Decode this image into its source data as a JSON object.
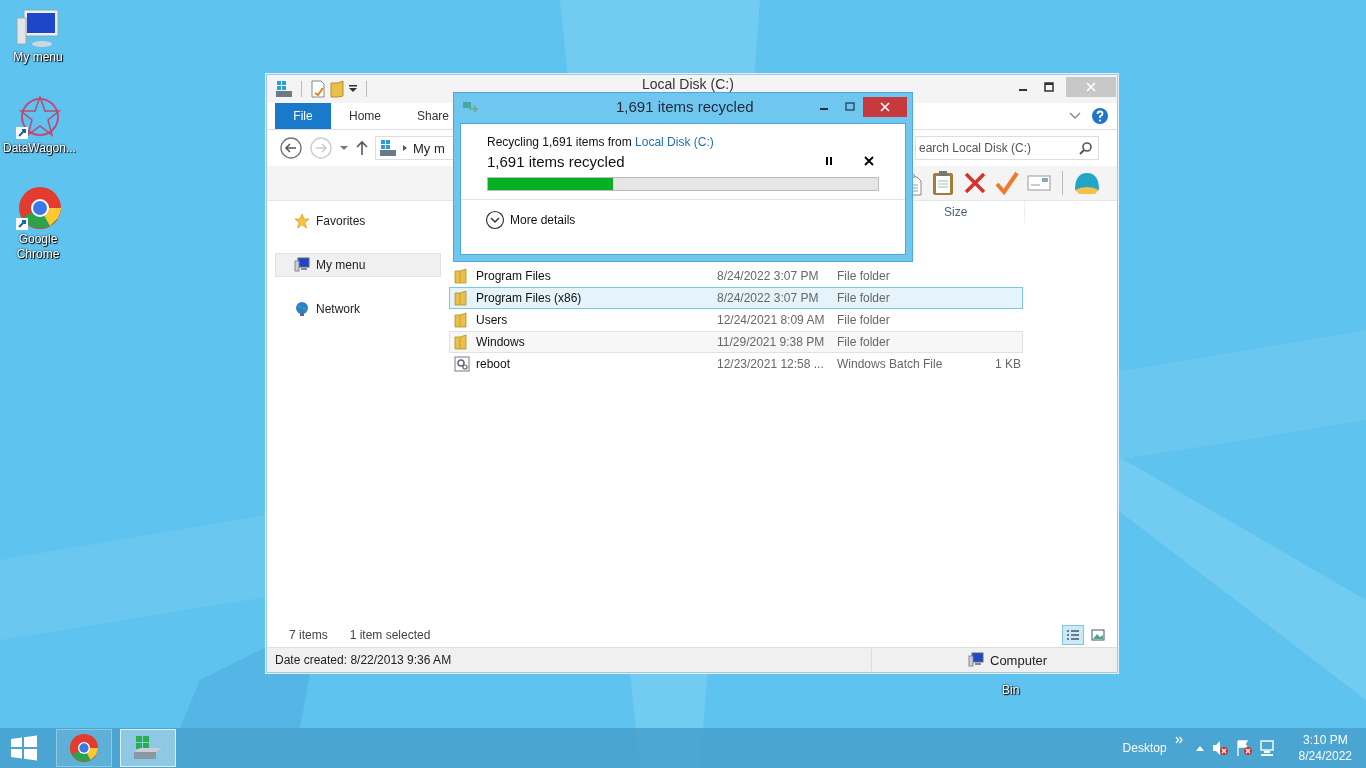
{
  "desktop_icons": [
    {
      "label": "My menu",
      "kind": "computer"
    },
    {
      "label": "DataWagon...",
      "kind": "star"
    },
    {
      "label": "Google Chrome",
      "kind": "chrome"
    }
  ],
  "recycle_bin": {
    "label": "Bin"
  },
  "explorer": {
    "title": "Local Disk (C:)",
    "ribbon_tabs": [
      {
        "label": "File",
        "kind": "menu"
      },
      {
        "label": "Home",
        "kind": "tab"
      },
      {
        "label": "Share",
        "kind": "tab"
      }
    ],
    "breadcrumb": "My m",
    "search": {
      "placeholder": "earch Local Disk (C:)"
    },
    "nav": [
      {
        "label": "Favorites",
        "kind": "favorites",
        "selected": false
      },
      {
        "label": "My menu",
        "kind": "computer",
        "selected": true
      },
      {
        "label": "Network",
        "kind": "network",
        "selected": false
      }
    ],
    "size_column": "Size",
    "rows": [
      {
        "name": "Program Files",
        "date": "8/24/2022 3:07 PM",
        "type": "File folder",
        "size": "",
        "kind": "folder",
        "selected": false,
        "hovered": false
      },
      {
        "name": "Program Files (x86)",
        "date": "8/24/2022 3:07 PM",
        "type": "File folder",
        "size": "",
        "kind": "folder",
        "selected": true,
        "hovered": false
      },
      {
        "name": "Users",
        "date": "12/24/2021 8:09 AM",
        "type": "File folder",
        "size": "",
        "kind": "folder",
        "selected": false,
        "hovered": false
      },
      {
        "name": "Windows",
        "date": "11/29/2021 9:38 PM",
        "type": "File folder",
        "size": "",
        "kind": "folder",
        "selected": false,
        "hovered": true
      },
      {
        "name": "reboot",
        "date": "12/23/2021 12:58 ...",
        "type": "Windows Batch File",
        "size": "1 KB",
        "kind": "batch",
        "selected": false,
        "hovered": false
      }
    ],
    "status": {
      "item_count": "7 items",
      "selection": "1 item selected"
    },
    "views": [
      {
        "kind": "details",
        "selected": true
      },
      {
        "kind": "thumbnails",
        "selected": false
      }
    ],
    "details_bar": {
      "info": "Date created: 8/22/2013 9:36 AM",
      "location": "Computer"
    }
  },
  "dialog": {
    "title": "1,691 items recycled",
    "source_prefix": "Recycling 1,691 items from ",
    "source_link": "Local Disk (C:)",
    "status": "1,691 items recycled",
    "level": 0.32,
    "more_details": "More details"
  },
  "taskbar": {
    "apps": [
      {
        "kind": "chrome",
        "selected": false
      },
      {
        "kind": "explorer",
        "selected": true
      }
    ],
    "desktop_label": "Desktop",
    "time": "3:10 PM",
    "date": "8/24/2022"
  }
}
